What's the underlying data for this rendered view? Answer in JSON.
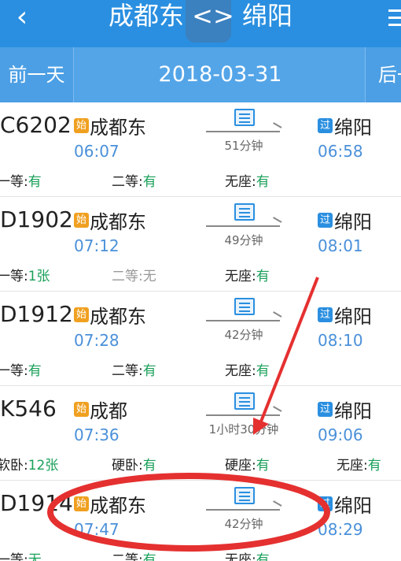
{
  "header": {
    "back_icon": "chevron-left-icon",
    "title": "成都东 <> 绵阳",
    "menu_icon": "list-menu-icon"
  },
  "datebar": {
    "prev_label": "前一天",
    "date": "2018-03-31",
    "next_label": "后一天"
  },
  "colors": {
    "header_bg": "#2a8fe0",
    "available": "#1aa05a",
    "time": "#4a90d9",
    "depart_badge": "#f0a020",
    "pass_badge": "#2a8fe0",
    "annotation": "#e53030"
  },
  "trains": [
    {
      "no": "C6202",
      "dep_badge": "始",
      "dep_station": "成都东",
      "dep_time": "06:07",
      "duration": "51分钟",
      "arr_badge": "过",
      "arr_station": "绵阳",
      "arr_time": "06:58",
      "seats": [
        {
          "label": "一等:",
          "value": "有"
        },
        {
          "label": "二等:",
          "value": "有"
        },
        {
          "label": "无座:",
          "value": "有"
        }
      ]
    },
    {
      "no": "D1902",
      "dep_badge": "始",
      "dep_station": "成都东",
      "dep_time": "07:12",
      "duration": "49分钟",
      "arr_badge": "过",
      "arr_station": "绵阳",
      "arr_time": "08:01",
      "seats": [
        {
          "label": "一等:",
          "value": "1张"
        },
        {
          "label": "二等:",
          "value": "无"
        },
        {
          "label": "无座:",
          "value": "有"
        }
      ]
    },
    {
      "no": "D1912",
      "dep_badge": "始",
      "dep_station": "成都东",
      "dep_time": "07:28",
      "duration": "42分钟",
      "arr_badge": "过",
      "arr_station": "绵阳",
      "arr_time": "08:10",
      "seats": [
        {
          "label": "一等:",
          "value": "有"
        },
        {
          "label": "二等:",
          "value": "有"
        },
        {
          "label": "无座:",
          "value": "有"
        }
      ]
    },
    {
      "no": "K546",
      "dep_badge": "始",
      "dep_station": "成都",
      "dep_time": "07:36",
      "duration": "1小时30分钟",
      "arr_badge": "过",
      "arr_station": "绵阳",
      "arr_time": "09:06",
      "seats": [
        {
          "label": "软卧:",
          "value": "12张"
        },
        {
          "label": "硬卧:",
          "value": "有"
        },
        {
          "label": "硬座:",
          "value": "有"
        },
        {
          "label": "无座:",
          "value": "有"
        }
      ]
    },
    {
      "no": "D1914",
      "dep_badge": "始",
      "dep_station": "成都东",
      "dep_time": "07:47",
      "duration": "42分钟",
      "arr_badge": "过",
      "arr_station": "绵阳",
      "arr_time": "08:29",
      "seats": [
        {
          "label": "一等:",
          "value": "无"
        },
        {
          "label": "二等:",
          "value": "有"
        },
        {
          "label": "无座:",
          "value": "有"
        }
      ]
    }
  ]
}
